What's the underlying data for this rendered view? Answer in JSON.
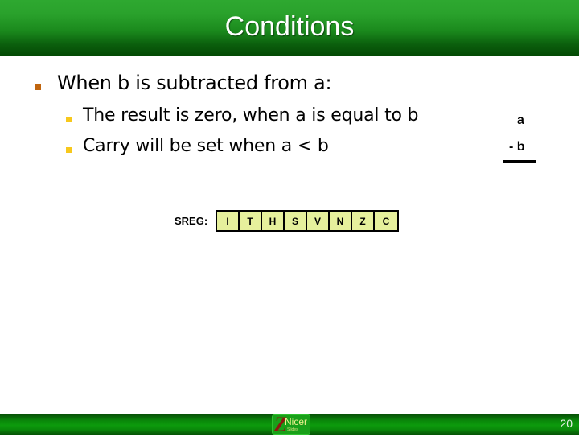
{
  "slide": {
    "title": "Conditions",
    "bullets": [
      {
        "text": "When b is subtracted from a:",
        "bullet_color": "#c0650e",
        "children": [
          {
            "text": "The result is zero, when a is equal to b",
            "bullet_color": "#f7c81c"
          },
          {
            "text": "Carry will be set when a < b",
            "bullet_color": "#f7c81c"
          }
        ]
      }
    ],
    "subtraction": {
      "top": "a",
      "bottom": "- b"
    },
    "sreg": {
      "label": "SREG:",
      "flags": [
        "I",
        "T",
        "H",
        "S",
        "V",
        "N",
        "Z",
        "C"
      ],
      "cell_color": "#e6f09c"
    }
  },
  "footer": {
    "logo": {
      "letter": "Z",
      "word": "Nicer",
      "tagline": "Slides"
    },
    "page_number": "20"
  },
  "colors": {
    "header_top": "#2ea830",
    "header_bottom": "#044a04",
    "footer_mid": "#0c9a0c"
  }
}
